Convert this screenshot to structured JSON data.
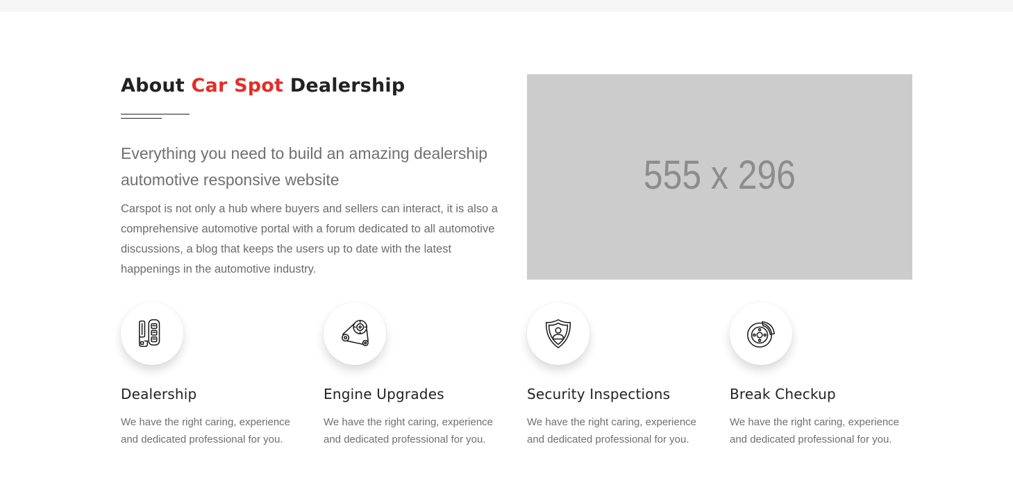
{
  "about": {
    "heading_prefix": "About",
    "heading_brand": "Car Spot",
    "heading_suffix": "Dealership",
    "lead": "Everything you need to build an amazing dealership automotive responsive website",
    "body": "Carspot is not only a hub where buyers and sellers can interact, it is also a comprehensive automotive portal with a forum dedicated to all automotive discussions, a blog that keeps the users up to date with the latest happenings in the automotive industry.",
    "image_placeholder": "555 x 296"
  },
  "features": [
    {
      "title": "Dealership",
      "description": "We have the right caring, experience and dedicated professional for you.",
      "icon": "car-key-icon"
    },
    {
      "title": "Engine Upgrades",
      "description": "We have the right caring, experience and dedicated professional for you.",
      "icon": "timing-belt-icon"
    },
    {
      "title": "Security Inspections",
      "description": "We have the right caring, experience and dedicated professional for you.",
      "icon": "shield-user-icon"
    },
    {
      "title": "Break Checkup",
      "description": "We have the right caring, experience and dedicated professional for you.",
      "icon": "brake-disc-icon"
    }
  ],
  "colors": {
    "accent": "#e52d27",
    "heading": "#222222",
    "text": "#6f6f6f",
    "placeholder_bg": "#cccccc"
  }
}
